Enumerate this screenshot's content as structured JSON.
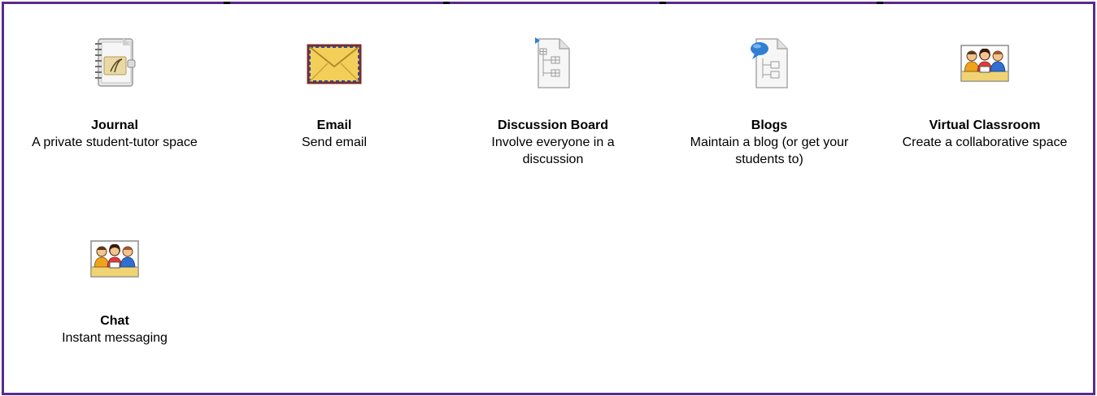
{
  "tools": [
    {
      "id": "journal",
      "title": "Journal",
      "description": "A private student-tutor space",
      "icon": "journal-icon"
    },
    {
      "id": "email",
      "title": "Email",
      "description": "Send email",
      "icon": "envelope-icon"
    },
    {
      "id": "discussion-board",
      "title": "Discussion Board",
      "description": "Involve everyone in a discussion",
      "icon": "discussion-board-icon"
    },
    {
      "id": "blogs",
      "title": "Blogs",
      "description": "Maintain a blog (or get your students to)",
      "icon": "blog-icon"
    },
    {
      "id": "virtual-classroom",
      "title": "Virtual Classroom",
      "description": "Create a collaborative space",
      "icon": "classroom-icon"
    },
    {
      "id": "chat",
      "title": "Chat",
      "description": "Instant messaging",
      "icon": "chat-icon"
    }
  ],
  "colors": {
    "frame_border": "#5b2a8c",
    "envelope": "#f3cf5a",
    "bubble": "#2f7fd4"
  }
}
